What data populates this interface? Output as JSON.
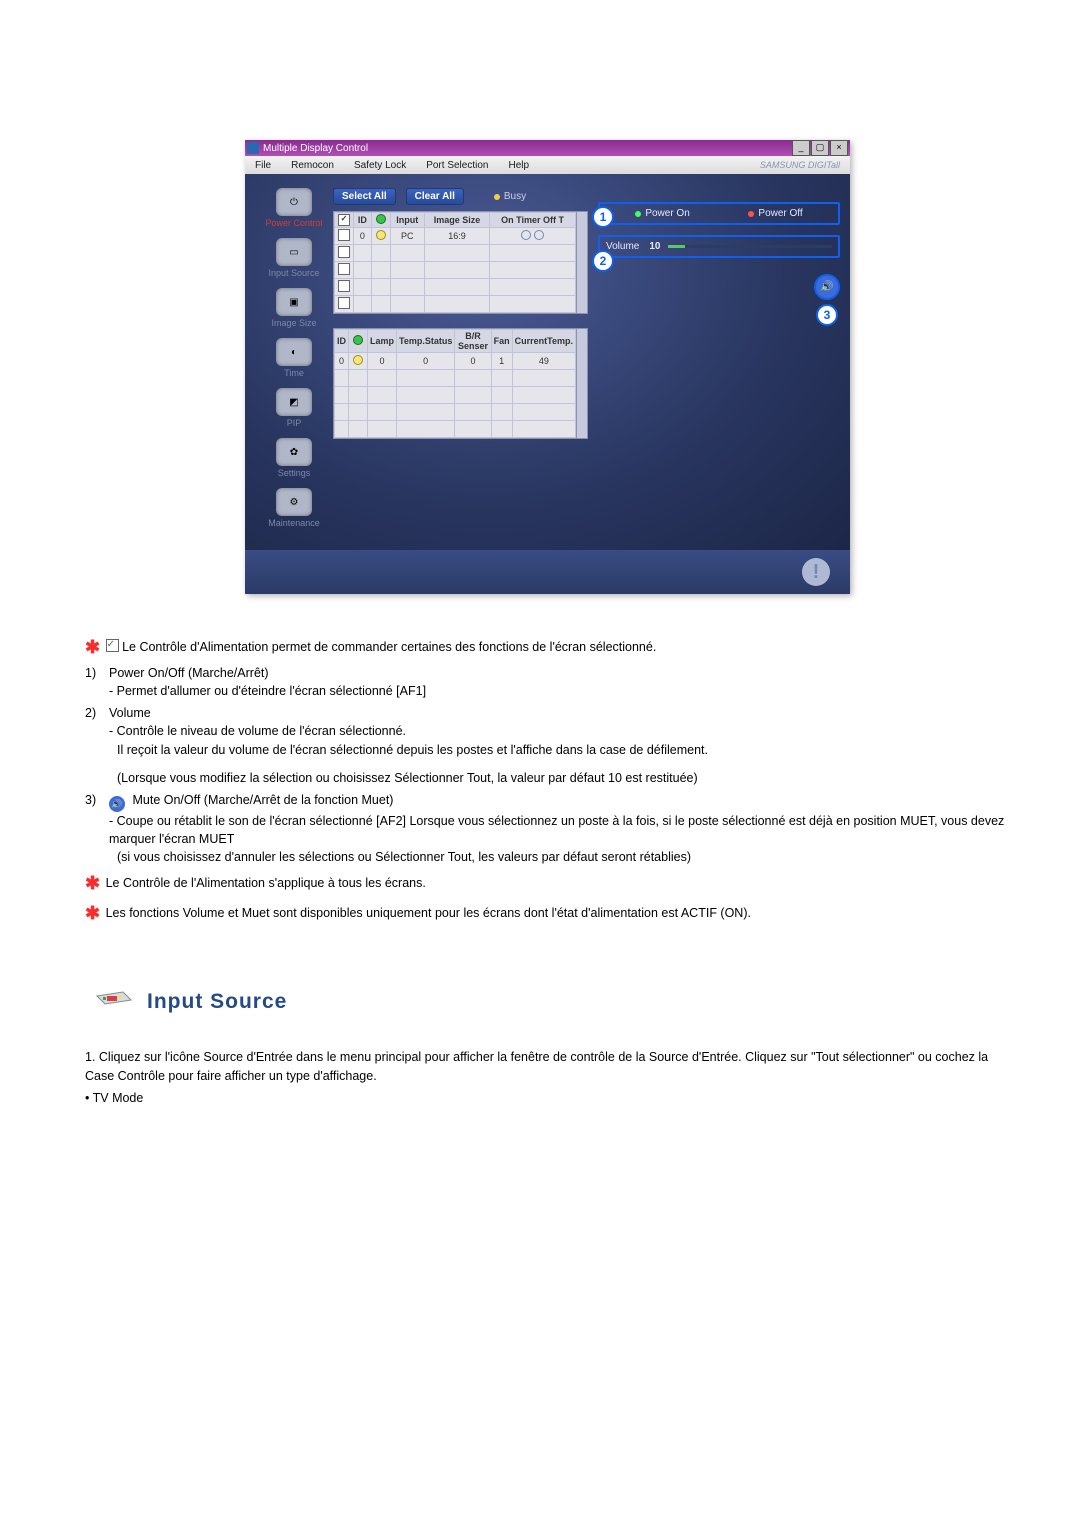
{
  "window": {
    "title": "Multiple Display Control",
    "brand": "SAMSUNG DIGITall"
  },
  "menu": [
    "File",
    "Remocon",
    "Safety Lock",
    "Port Selection",
    "Help"
  ],
  "sidebar": [
    {
      "label": "Power Control",
      "style": "red"
    },
    {
      "label": "Input Source",
      "style": "dim"
    },
    {
      "label": "Image Size",
      "style": "dim"
    },
    {
      "label": "Time",
      "style": "dim"
    },
    {
      "label": "PIP",
      "style": "dim"
    },
    {
      "label": "Settings",
      "style": "dim"
    },
    {
      "label": "Maintenance",
      "style": "dim"
    }
  ],
  "top_buttons": {
    "select_all": "Select All",
    "clear_all": "Clear All",
    "busy": "Busy"
  },
  "table1": {
    "headers": [
      "",
      "ID",
      "",
      "Input",
      "Image Size",
      "On Timer Off T"
    ],
    "rows": [
      [
        "ck",
        "0",
        "g-o",
        "PC",
        "16:9",
        "hollow hollow"
      ],
      [
        "",
        "",
        "",
        "",
        "",
        ""
      ],
      [
        "",
        "",
        "",
        "",
        "",
        ""
      ],
      [
        "",
        "",
        "",
        "",
        "",
        ""
      ],
      [
        "",
        "",
        "",
        "",
        "",
        ""
      ]
    ]
  },
  "table2": {
    "headers": [
      "ID",
      "",
      "Lamp",
      "Temp.Status",
      "B/R Senser",
      "Fan",
      "CurrentTemp."
    ],
    "rows": [
      [
        "0",
        "g",
        "0",
        "0",
        "0",
        "1",
        "49"
      ],
      [
        "",
        "",
        "",
        "",
        "",
        "",
        ""
      ],
      [
        "",
        "",
        "",
        "",
        "",
        "",
        ""
      ],
      [
        "",
        "",
        "",
        "",
        "",
        "",
        ""
      ],
      [
        "",
        "",
        "",
        "",
        "",
        "",
        ""
      ]
    ]
  },
  "power": {
    "on": "Power On",
    "off": "Power Off"
  },
  "volume": {
    "label": "Volume",
    "value": "10"
  },
  "annotations": {
    "one": "1",
    "two": "2",
    "three": "3"
  },
  "doc": {
    "intro": "Le Contrôle d'Alimentation permet de commander certaines des fonctions de l'écran sélectionné.",
    "i1_n": "1)",
    "i1_t": "Power On/Off (Marche/Arrêt)",
    "i1_s": "- Permet d'allumer ou d'éteindre l'écran sélectionné [AF1]",
    "i2_n": "2)",
    "i2_t": "Volume",
    "i2_s1": "- Contrôle le niveau de volume de l'écran sélectionné.",
    "i2_s2": "Il reçoit la valeur du volume de l'écran sélectionné depuis les postes et l'affiche dans la case de défilement.",
    "i2_s3": "(Lorsque vous modifiez la sélection ou choisissez Sélectionner Tout, la valeur par défaut 10 est restituée)",
    "i3_n": "3)",
    "i3_t": "Mute On/Off (Marche/Arrêt de la fonction Muet)",
    "i3_s1": "- Coupe ou rétablit le son de l'écran sélectionné [AF2] Lorsque vous sélectionnez un poste à la fois, si le poste sélectionné est déjà en position MUET, vous devez marquer l'écran MUET",
    "i3_s2": "(si vous choisissez d'annuler les sélections ou Sélectionner Tout, les valeurs par défaut seront rétablies)",
    "star1": "Le Contrôle de l'Alimentation s'applique à tous les écrans.",
    "star2": "Les fonctions Volume et Muet sont disponibles uniquement pour les écrans dont l'état d'alimentation est ACTIF (ON).",
    "section_title": "Input Source",
    "is1": "1. Cliquez sur l'icône Source d'Entrée dans le menu principal pour afficher la fenêtre de contrôle de la Source d'Entrée. Cliquez sur \"Tout sélectionner\" ou cochez la Case Contrôle pour faire afficher un type d'affichage.",
    "is2": "• TV Mode"
  }
}
